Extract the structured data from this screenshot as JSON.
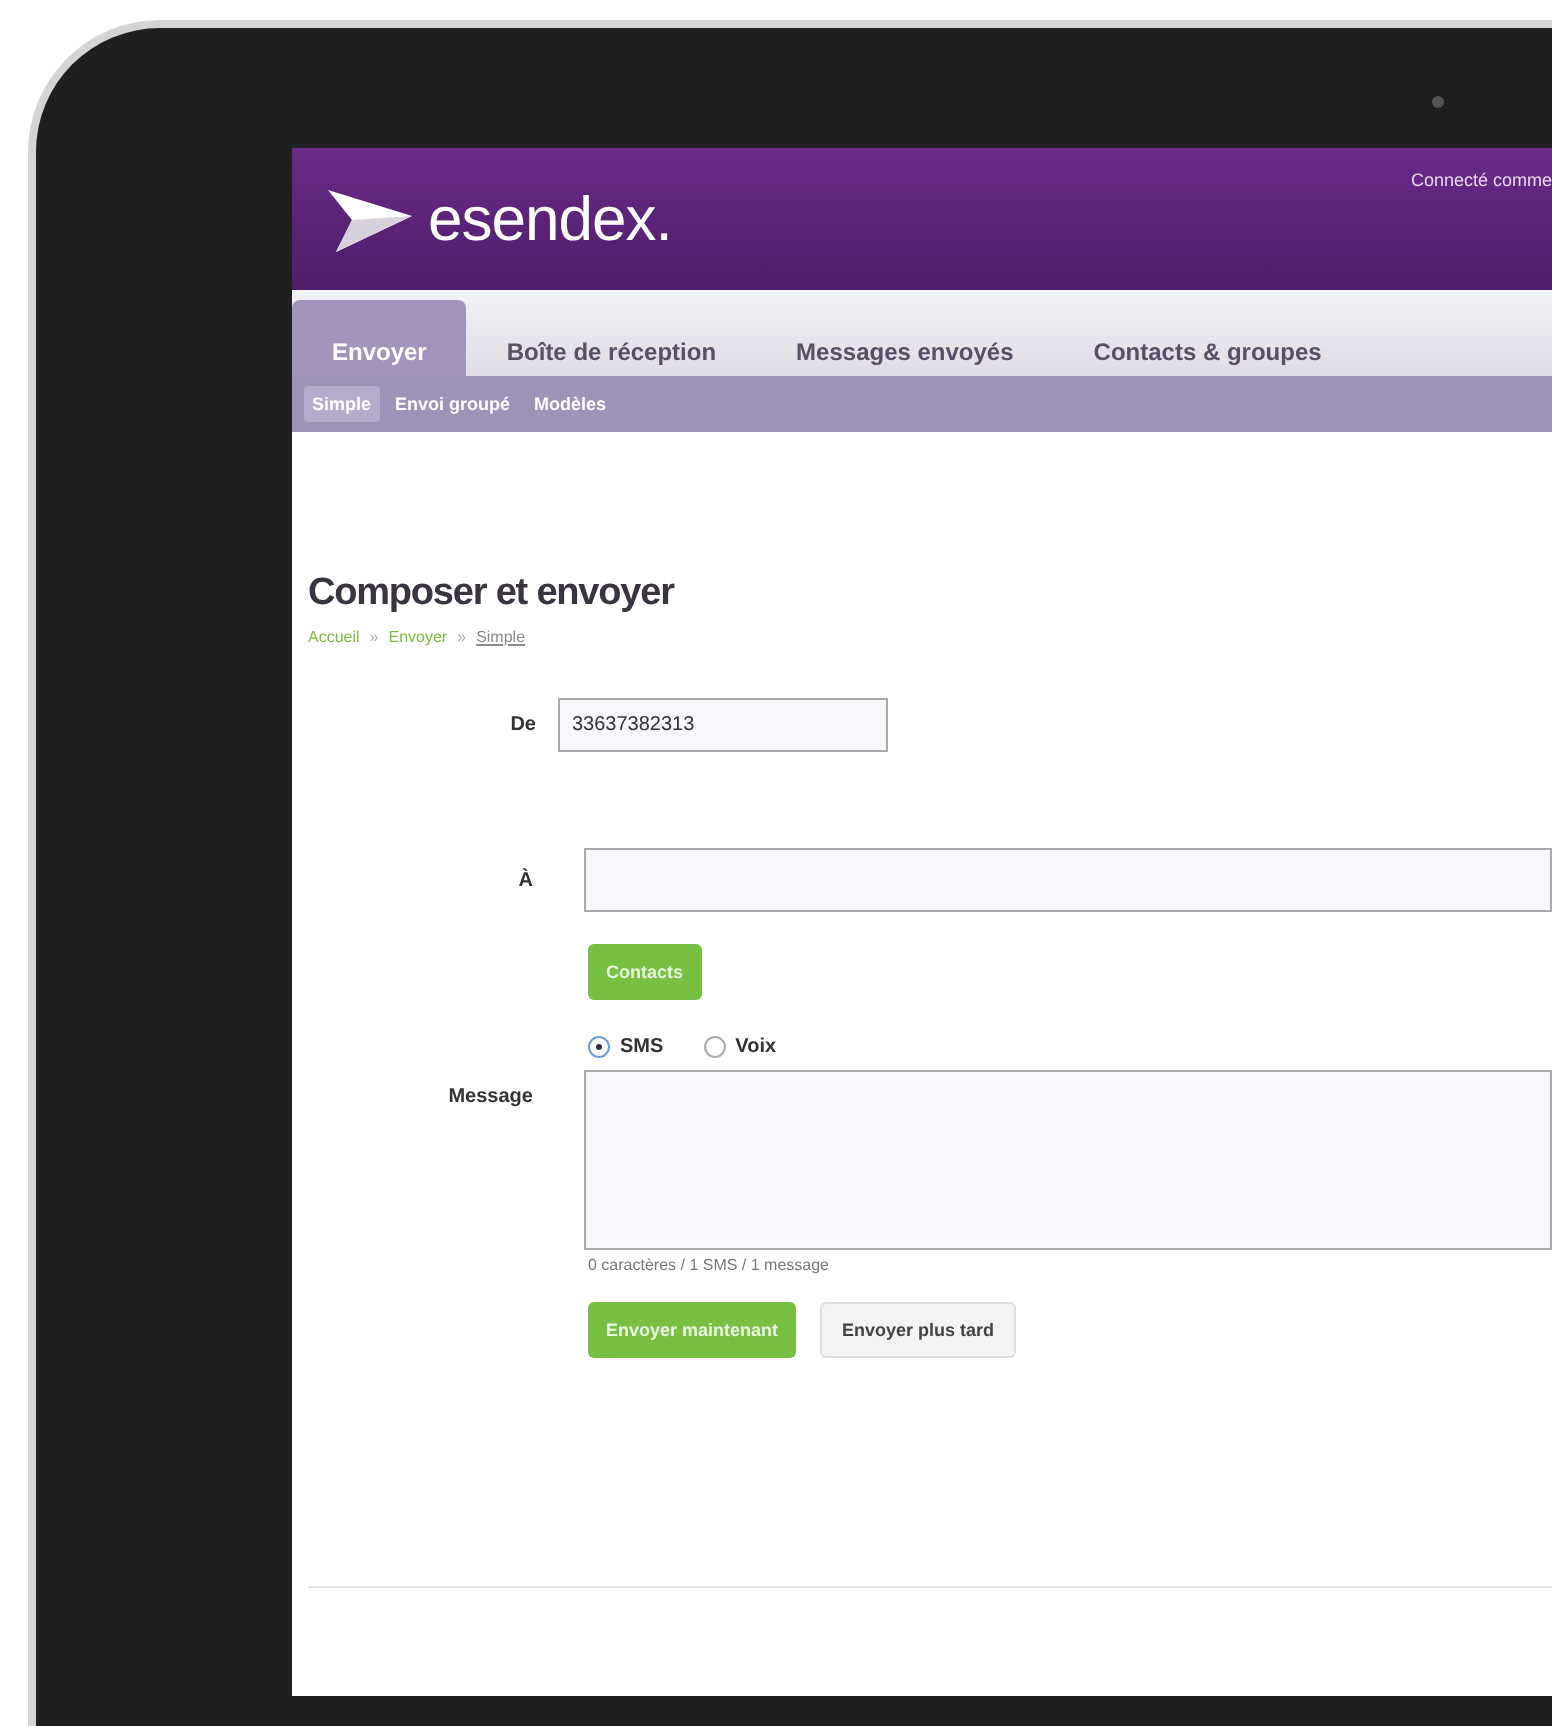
{
  "header": {
    "logo": "esendex.",
    "login_text": "Connecté comme"
  },
  "tabs": [
    {
      "label": "Envoyer",
      "selected": true
    },
    {
      "label": "Boîte de réception",
      "selected": false
    },
    {
      "label": "Messages envoyés",
      "selected": false
    },
    {
      "label": "Contacts & groupes",
      "selected": false
    }
  ],
  "subtabs": [
    {
      "label": "Simple",
      "selected": true
    },
    {
      "label": "Envoi groupé",
      "selected": false
    },
    {
      "label": "Modèles",
      "selected": false
    }
  ],
  "page": {
    "title": "Composer et envoyer",
    "breadcrumb": [
      {
        "label": "Accueil",
        "current": false
      },
      {
        "label": "»",
        "current": false,
        "kind": "separator"
      },
      {
        "label": "Envoyer",
        "current": false
      },
      {
        "label": "»",
        "current": false,
        "kind": "separator"
      },
      {
        "label": "Simple",
        "current": true
      }
    ]
  },
  "form": {
    "from": {
      "label": "De",
      "value": "33637382313"
    },
    "to": {
      "label": "À"
    },
    "contacts_button": "Contacts",
    "message_types": [
      {
        "label": "SMS",
        "selected": true
      },
      {
        "label": "Voix",
        "selected": false
      }
    ],
    "message": {
      "label": "Message"
    },
    "counter": "0 caractères / 1 SMS / 1 message",
    "buttons": [
      {
        "label": "Envoyer maintenant",
        "kind": "primary"
      },
      {
        "label": "Envoyer plus tard",
        "kind": "secondary"
      }
    ]
  }
}
